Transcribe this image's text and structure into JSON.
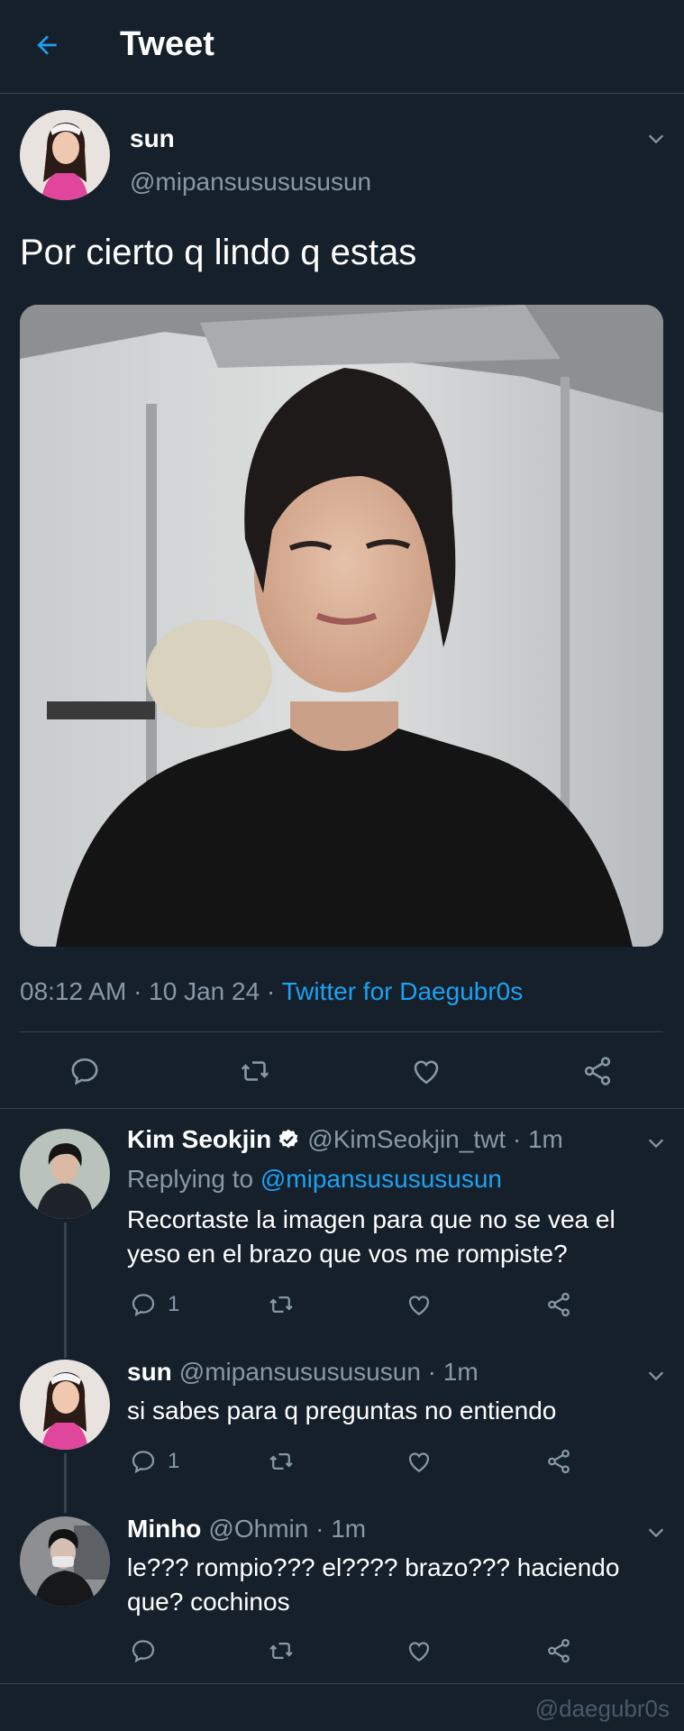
{
  "header": {
    "title": "Tweet"
  },
  "main_tweet": {
    "name": "sun",
    "handle": "@mipansususususun",
    "text": "Por cierto q lindo q estas",
    "meta_time": "08:12 AM · 10 Jan 24 · ",
    "meta_source": "Twitter for Daegubr0s"
  },
  "replies": [
    {
      "name": "Kim Seokjin",
      "handle": "@KimSeokjin_twt · 1m",
      "replying_prefix": "Replying to ",
      "replying_mention": "@mipansususususun",
      "text": "Recortaste la imagen para que no se vea el yeso en el brazo que vos me rompiste?",
      "reply_count": "1"
    },
    {
      "name": "sun",
      "handle": "@mipansususususun · 1m",
      "text": "si sabes para q preguntas no entiendo",
      "reply_count": "1"
    },
    {
      "name": "Minho",
      "handle": "@Ohmin · 1m",
      "text": "le??? rompio??? el???? brazo??? haciendo que? cochinos",
      "reply_count": ""
    }
  ],
  "watermark": "@daegubr0s",
  "colors": {
    "background": "#15202b",
    "accent": "#1da1f2",
    "secondary": "#8899a6",
    "divider": "#38444d"
  }
}
